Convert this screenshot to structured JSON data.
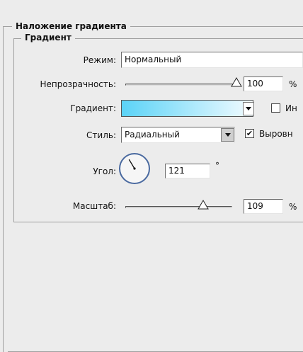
{
  "panel": {
    "outer_legend": "Наложение градиента",
    "inner_legend": "Градиент"
  },
  "mode": {
    "label": "Режим:",
    "value": "Нормальный"
  },
  "opacity": {
    "label": "Непрозрачность:",
    "value": "100",
    "unit": "%",
    "level_percent": 100
  },
  "gradient": {
    "label": "Градиент:",
    "start_color": "#5bd3f7",
    "end_color": "#f2fbff",
    "invert_label": "Ин",
    "invert_checked": false
  },
  "style": {
    "label": "Стиль:",
    "value": "Радиальный",
    "align_label": "Выровн",
    "align_checked": true,
    "check_glyph": "✔"
  },
  "angle": {
    "label": "Угол:",
    "value": "121",
    "unit": "°",
    "degrees": 121
  },
  "scale": {
    "label": "Масштаб:",
    "value": "109",
    "unit": "%",
    "level_fraction": 0.73
  }
}
